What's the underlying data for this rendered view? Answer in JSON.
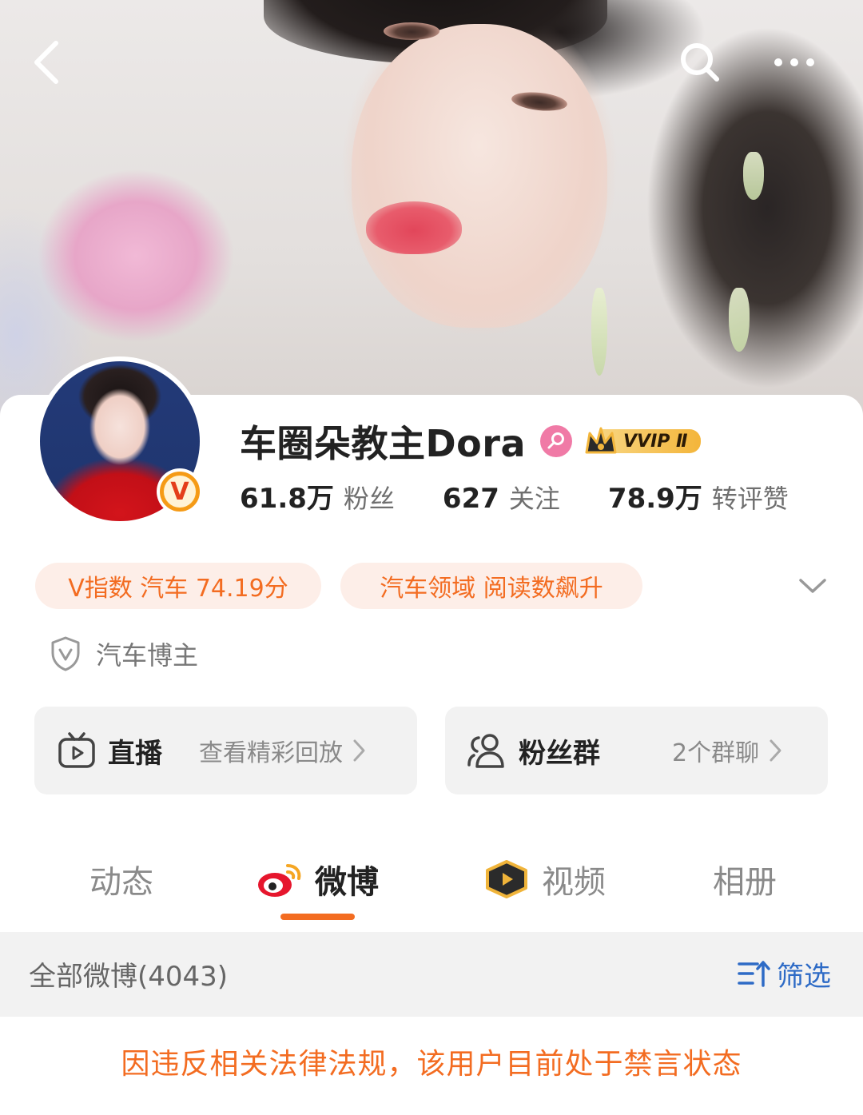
{
  "header": {
    "back_icon": "chevron-left-icon",
    "search_icon": "search-icon",
    "more_icon": "more-horizontal-icon"
  },
  "profile": {
    "name": "车圈朵教主Dora",
    "gender_icon": "female-icon",
    "vip_label": "VVIP Ⅱ",
    "verified_badge": "V",
    "stats": [
      {
        "num": "61.8万",
        "label": "粉丝"
      },
      {
        "num": "627",
        "label": "关注"
      },
      {
        "num": "78.9万",
        "label": "转评赞"
      }
    ],
    "tags": [
      "V指数 汽车 74.19分",
      "汽车领域 阅读数飙升"
    ],
    "role": "汽车博主"
  },
  "features": {
    "live": {
      "title": "直播",
      "sub": "查看精彩回放"
    },
    "fans": {
      "title": "粉丝群",
      "sub": "2个群聊"
    }
  },
  "tabs": [
    "动态",
    "微博",
    "视频",
    "相册"
  ],
  "active_tab": "微博",
  "feed": {
    "header": "全部微博(4043)",
    "filter_label": "筛选",
    "notice": "因违反相关法律法规，该用户目前处于禁言状态"
  },
  "colors": {
    "accent": "#f36c21",
    "filter_blue": "#2e6bc6",
    "pill_bg": "#fdeee8"
  }
}
